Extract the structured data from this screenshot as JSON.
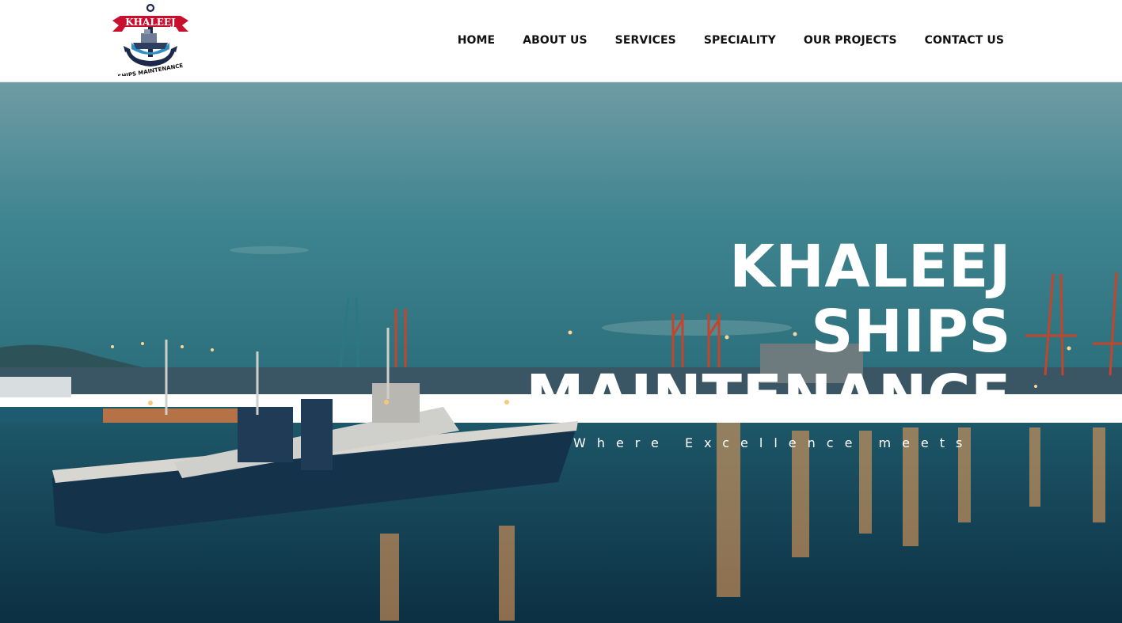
{
  "logo": {
    "brand_text": "KHALEEJ",
    "tagline_text": "SHIPS MAINTENANCE"
  },
  "nav": {
    "items": [
      {
        "label": "HOME"
      },
      {
        "label": "ABOUT US"
      },
      {
        "label": "SERVICES"
      },
      {
        "label": "SPECIALITY"
      },
      {
        "label": "OUR PROJECTS"
      },
      {
        "label": "CONTACT US"
      }
    ]
  },
  "hero": {
    "title_lines": [
      "KHALEEJ",
      "SHIPS",
      "MAINTENANCE"
    ],
    "subtitle": "Where Excellence meets"
  },
  "colors": {
    "header_bg": "#ffffff",
    "nav_text": "#111111",
    "logo_red": "#c8102e",
    "logo_navy": "#1b2a4a",
    "sky_top": "#6d9aa3",
    "sky_bottom": "#2f7480",
    "water": "#0f3a4e",
    "light_orange": "#f5a35a"
  }
}
